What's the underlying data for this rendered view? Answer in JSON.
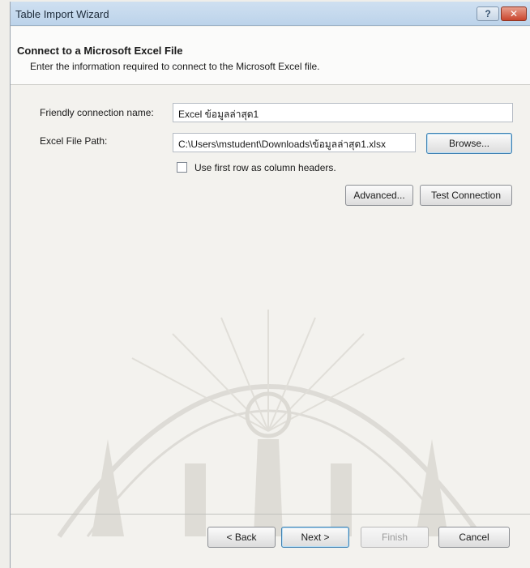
{
  "window": {
    "title": "Table Import Wizard",
    "help_label": "?",
    "close_label": "✕"
  },
  "header": {
    "title": "Connect to a Microsoft Excel File",
    "subtitle": "Enter the information required to connect to the Microsoft Excel file."
  },
  "form": {
    "friendly_label": "Friendly connection name:",
    "friendly_value": "Excel ข้อมูลล่าสุด1",
    "path_label": "Excel File Path:",
    "path_value": "C:\\Users\\mstudent\\Downloads\\ข้อมูลล่าสุด1.xlsx",
    "browse_label": "Browse...",
    "checkbox_label": "Use first row as column headers.",
    "checkbox_checked": false,
    "advanced_label": "Advanced...",
    "test_label": "Test Connection"
  },
  "footer": {
    "back_label": "< Back",
    "next_label": "Next >",
    "finish_label": "Finish",
    "cancel_label": "Cancel"
  }
}
